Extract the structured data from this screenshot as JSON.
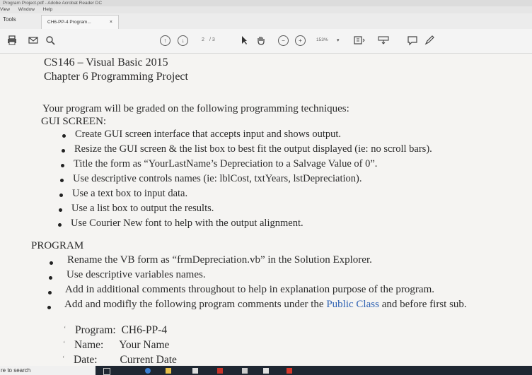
{
  "window": {
    "title": "Program Project.pdf - Adobe Acrobat Reader DC"
  },
  "menu": [
    "View",
    "Window",
    "Help"
  ],
  "tabs": {
    "tools": "Tools",
    "document": "CH6-PP-4 Program...",
    "close": "×"
  },
  "toolbar": {
    "page_current": "2",
    "page_total": "/ 3",
    "zoom": "153%"
  },
  "document": {
    "heading1": "CS146 – Visual Basic 2015",
    "heading2": "Chapter 6 Programming Project",
    "intro": "Your program will be graded on the following programming techniques:",
    "gui_heading": "GUI SCREEN:",
    "gui_items": [
      "Create GUI screen interface that accepts input and shows output.",
      "Resize the GUI screen & the list box to best fit the output displayed (ie: no scroll bars).",
      "Title the form as “YourLastName’s Depreciation to a Salvage Value of 0”.",
      "Use descriptive controls names (ie: lblCost, txtYears, lstDepreciation).",
      "Use a text box to input data.",
      "Use a list box to output the results.",
      "Use Courier New font to help with the output alignment."
    ],
    "program_heading": "PROGRAM",
    "program_items": [
      "Rename the VB form as “frmDepreciation.vb” in the Solution Explorer.",
      "Use descriptive variables names.",
      "Add in additional comments throughout to help in explanation purpose of the program."
    ],
    "program_last_prefix": "Add and modifly the following program comments under the",
    "program_last_link": "Public Class",
    "program_last_suffix": "and before first sub.",
    "comment_program_label": "Program:",
    "comment_program_value": "CH6-PP-4",
    "comment_name_label": "Name:",
    "comment_name_value": "Your Name",
    "comment_date_label": "Date:",
    "comment_date_value": "Current Date"
  },
  "taskbar": {
    "search": "re to search"
  }
}
